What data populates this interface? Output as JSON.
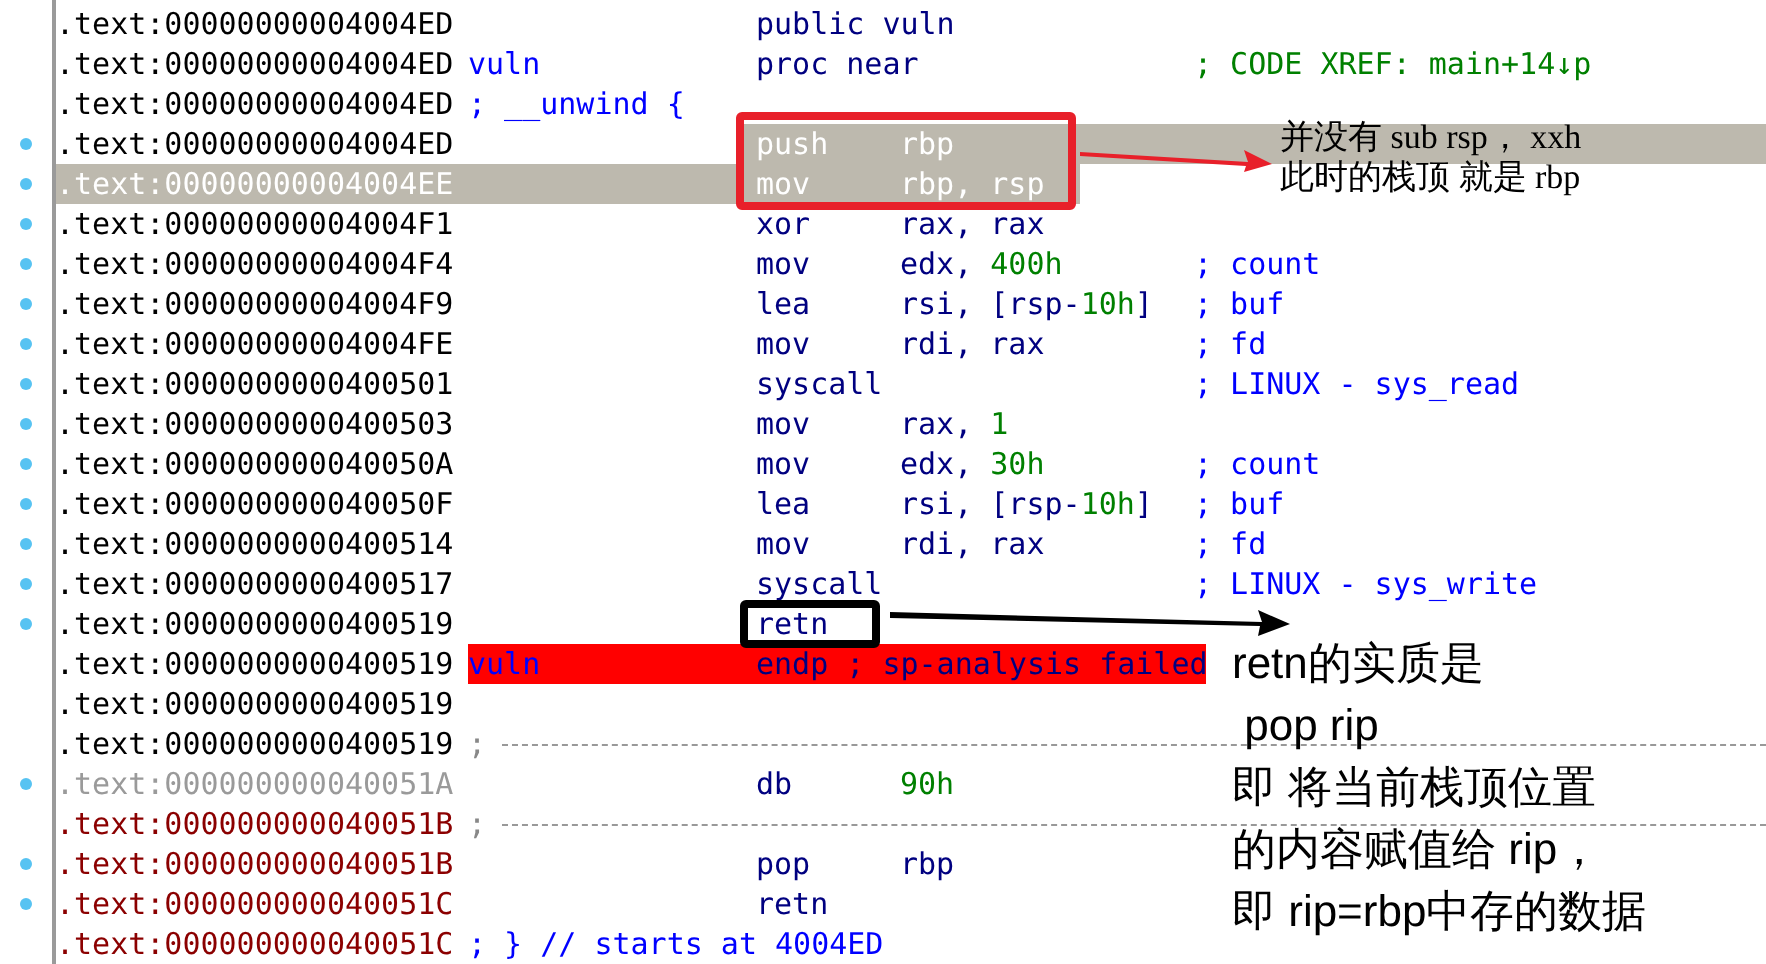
{
  "listing": {
    "rows": [
      {
        "address": {
          "text": ".text:00000000004004ED",
          "color": "#000000"
        },
        "dot": false,
        "selected": false,
        "highlighted": false,
        "error": false,
        "mnemonic": "public vuln"
      },
      {
        "address": {
          "text": ".text:00000000004004ED",
          "color": "#000000"
        },
        "dot": false,
        "selected": false,
        "highlighted": false,
        "error": false,
        "label": "vuln",
        "mnemonic": "proc near",
        "comment": {
          "text": "; CODE XREF: main+14↓p",
          "color": "#008000"
        }
      },
      {
        "address": {
          "text": ".text:00000000004004ED",
          "color": "#000000"
        },
        "dot": false,
        "selected": false,
        "highlighted": false,
        "error": false,
        "label": "; __unwind {"
      },
      {
        "address": {
          "text": ".text:00000000004004ED",
          "color": "#000000"
        },
        "dot": true,
        "selected": false,
        "highlighted": true,
        "error": false,
        "mnemonic": "push",
        "operands": [
          {
            "text": "rbp",
            "kind": "reg"
          }
        ]
      },
      {
        "address": {
          "text": ".text:00000000004004EE",
          "color": "#ffffff"
        },
        "dot": true,
        "selected": true,
        "highlighted": false,
        "error": false,
        "mnemonic": "mov",
        "operands": [
          {
            "text": "rbp, rsp",
            "kind": "reg"
          }
        ]
      },
      {
        "address": {
          "text": ".text:00000000004004F1",
          "color": "#000000"
        },
        "dot": true,
        "selected": false,
        "highlighted": false,
        "error": false,
        "mnemonic": "xor",
        "operands": [
          {
            "text": "rax, rax",
            "kind": "reg"
          }
        ]
      },
      {
        "address": {
          "text": ".text:00000000004004F4",
          "color": "#000000"
        },
        "dot": true,
        "selected": false,
        "highlighted": false,
        "error": false,
        "mnemonic": "mov",
        "operands": [
          {
            "text": "edx, ",
            "kind": "reg"
          },
          {
            "text": "400h",
            "kind": "num"
          }
        ],
        "comment": {
          "text": "; count",
          "color": "#0000ff"
        }
      },
      {
        "address": {
          "text": ".text:00000000004004F9",
          "color": "#000000"
        },
        "dot": true,
        "selected": false,
        "highlighted": false,
        "error": false,
        "mnemonic": "lea",
        "operands": [
          {
            "text": "rsi, [rsp-",
            "kind": "reg"
          },
          {
            "text": "10h",
            "kind": "num"
          },
          {
            "text": "]",
            "kind": "reg"
          }
        ],
        "comment": {
          "text": "; buf",
          "color": "#0000ff"
        }
      },
      {
        "address": {
          "text": ".text:00000000004004FE",
          "color": "#000000"
        },
        "dot": true,
        "selected": false,
        "highlighted": false,
        "error": false,
        "mnemonic": "mov",
        "operands": [
          {
            "text": "rdi, rax",
            "kind": "reg"
          }
        ],
        "comment": {
          "text": "; fd",
          "color": "#0000ff"
        }
      },
      {
        "address": {
          "text": ".text:0000000000400501",
          "color": "#000000"
        },
        "dot": true,
        "selected": false,
        "highlighted": false,
        "error": false,
        "mnemonic": "syscall",
        "comment": {
          "text": "; LINUX - sys_read",
          "color": "#0000ff"
        }
      },
      {
        "address": {
          "text": ".text:0000000000400503",
          "color": "#000000"
        },
        "dot": true,
        "selected": false,
        "highlighted": false,
        "error": false,
        "mnemonic": "mov",
        "operands": [
          {
            "text": "rax, ",
            "kind": "reg"
          },
          {
            "text": "1",
            "kind": "num"
          }
        ]
      },
      {
        "address": {
          "text": ".text:000000000040050A",
          "color": "#000000"
        },
        "dot": true,
        "selected": false,
        "highlighted": false,
        "error": false,
        "mnemonic": "mov",
        "operands": [
          {
            "text": "edx, ",
            "kind": "reg"
          },
          {
            "text": "30h",
            "kind": "num"
          }
        ],
        "comment": {
          "text": "; count",
          "color": "#0000ff"
        }
      },
      {
        "address": {
          "text": ".text:000000000040050F",
          "color": "#000000"
        },
        "dot": true,
        "selected": false,
        "highlighted": false,
        "error": false,
        "mnemonic": "lea",
        "operands": [
          {
            "text": "rsi, [rsp-",
            "kind": "reg"
          },
          {
            "text": "10h",
            "kind": "num"
          },
          {
            "text": "]",
            "kind": "reg"
          }
        ],
        "comment": {
          "text": "; buf",
          "color": "#0000ff"
        }
      },
      {
        "address": {
          "text": ".text:0000000000400514",
          "color": "#000000"
        },
        "dot": true,
        "selected": false,
        "highlighted": false,
        "error": false,
        "mnemonic": "mov",
        "operands": [
          {
            "text": "rdi, rax",
            "kind": "reg"
          }
        ],
        "comment": {
          "text": "; fd",
          "color": "#0000ff"
        }
      },
      {
        "address": {
          "text": ".text:0000000000400517",
          "color": "#000000"
        },
        "dot": true,
        "selected": false,
        "highlighted": false,
        "error": false,
        "mnemonic": "syscall",
        "comment": {
          "text": "; LINUX - sys_write",
          "color": "#0000ff"
        }
      },
      {
        "address": {
          "text": ".text:0000000000400519",
          "color": "#000000"
        },
        "dot": true,
        "selected": false,
        "highlighted": false,
        "error": false,
        "mnemonic": "retn"
      },
      {
        "address": {
          "text": ".text:0000000000400519",
          "color": "#000000"
        },
        "dot": false,
        "selected": false,
        "highlighted": false,
        "error": true,
        "label": "vuln",
        "mnemonic": "endp ; sp-analysis failed"
      },
      {
        "address": {
          "text": ".text:0000000000400519",
          "color": "#000000"
        },
        "dot": false,
        "selected": false,
        "highlighted": false,
        "error": false
      },
      {
        "address": {
          "text": ".text:0000000000400519",
          "color": "#000000"
        },
        "dot": false,
        "selected": false,
        "highlighted": false,
        "error": false,
        "separator": ";"
      },
      {
        "address": {
          "text": ".text:000000000040051A",
          "color": "#9a9a9a"
        },
        "dot": true,
        "selected": false,
        "highlighted": false,
        "error": false,
        "mnemonic": "db",
        "operands": [
          {
            "text": "90h",
            "kind": "num"
          }
        ]
      },
      {
        "address": {
          "text": ".text:000000000040051B",
          "color": "#8b0000"
        },
        "dot": false,
        "selected": false,
        "highlighted": false,
        "error": false,
        "separator": ";"
      },
      {
        "address": {
          "text": ".text:000000000040051B",
          "color": "#8b0000"
        },
        "dot": true,
        "selected": false,
        "highlighted": false,
        "error": false,
        "mnemonic": "pop",
        "operands": [
          {
            "text": "rbp",
            "kind": "reg"
          }
        ]
      },
      {
        "address": {
          "text": ".text:000000000040051C",
          "color": "#8b0000"
        },
        "dot": true,
        "selected": false,
        "highlighted": false,
        "error": false,
        "mnemonic": "retn"
      },
      {
        "address": {
          "text": ".text:000000000040051C",
          "color": "#8b0000"
        },
        "dot": false,
        "selected": false,
        "highlighted": false,
        "error": false,
        "label": "; } // starts at 4004ED"
      }
    ]
  },
  "annotations": [
    {
      "kind": "serif",
      "lines": [
        "并没有 sub rsp， xxh",
        "此时的栈顶 就是 rbp"
      ]
    },
    {
      "kind": "sans",
      "lines": [
        "retn的实质是",
        " pop rip",
        "即 将当前栈顶位置",
        "的内容赋值给 rip，",
        "即 rip=rbp中存的数据"
      ]
    }
  ]
}
